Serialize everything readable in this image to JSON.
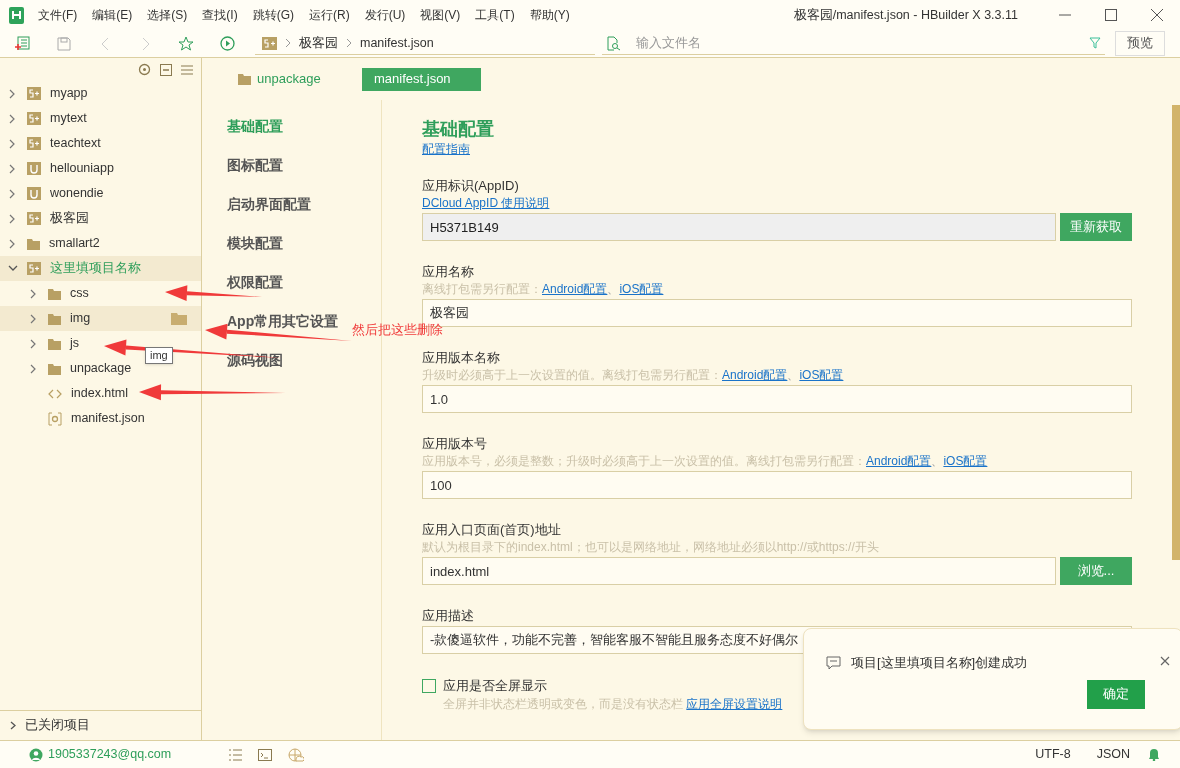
{
  "window": {
    "title": "极客园/manifest.json - HBuilder X 3.3.11"
  },
  "menu": [
    "文件(F)",
    "编辑(E)",
    "选择(S)",
    "查找(I)",
    "跳转(G)",
    "运行(R)",
    "发行(U)",
    "视图(V)",
    "工具(T)",
    "帮助(Y)"
  ],
  "toolbar": {
    "breadcrumb": [
      "极客园",
      "manifest.json"
    ],
    "search": {
      "placeholder": "输入文件名"
    },
    "preview_button": "预览"
  },
  "sidebar": {
    "items": [
      {
        "label": "myapp",
        "kind": "project",
        "expanded": false,
        "highlighted": false,
        "current": false
      },
      {
        "label": "mytext",
        "kind": "project",
        "expanded": false,
        "highlighted": false,
        "current": false
      },
      {
        "label": "teachtext",
        "kind": "project",
        "expanded": false,
        "highlighted": false,
        "current": false
      },
      {
        "label": "hellouniapp",
        "kind": "uniproject",
        "expanded": false,
        "highlighted": false,
        "current": false
      },
      {
        "label": "wonendie",
        "kind": "uniproject",
        "expanded": false,
        "highlighted": false,
        "current": false
      },
      {
        "label": "极客园",
        "kind": "project",
        "expanded": false,
        "highlighted": false,
        "current": false
      },
      {
        "label": "smallart2",
        "kind": "folder",
        "expanded": false,
        "highlighted": false,
        "current": false
      },
      {
        "label": "这里填项目名称",
        "kind": "project",
        "expanded": true,
        "highlighted": true,
        "current": true,
        "children": [
          {
            "label": "css",
            "kind": "folder",
            "expanded": false,
            "highlighted": false,
            "current": false
          },
          {
            "label": "img",
            "kind": "folder",
            "expanded": false,
            "highlighted": true,
            "current": false
          },
          {
            "label": "js",
            "kind": "folder",
            "expanded": false,
            "highlighted": false,
            "current": false
          },
          {
            "label": "unpackage",
            "kind": "folder",
            "expanded": false,
            "highlighted": false,
            "current": false
          },
          {
            "label": "index.html",
            "kind": "html",
            "highlighted": false,
            "current": false
          },
          {
            "label": "manifest.json",
            "kind": "json",
            "highlighted": false,
            "current": false
          }
        ]
      }
    ],
    "closed_projects": "已关闭项目"
  },
  "editor": {
    "tabs": [
      {
        "label": "unpackage",
        "kind": "folder",
        "selected": false
      },
      {
        "label": "manifest.json",
        "kind": "file",
        "selected": true
      }
    ],
    "nav": [
      {
        "label": "基础配置",
        "selected": true
      },
      {
        "label": "图标配置",
        "selected": false
      },
      {
        "label": "启动界面配置",
        "selected": false
      },
      {
        "label": "模块配置",
        "selected": false
      },
      {
        "label": "权限配置",
        "selected": false
      },
      {
        "label": "App常用其它设置",
        "selected": false
      },
      {
        "label": "源码视图",
        "selected": false
      }
    ],
    "heading": "基础配置",
    "guide_link": "配置指南",
    "fields": [
      {
        "kind": "text",
        "label": "应用标识(AppID)",
        "links": [
          "DCloud AppID 使用说明"
        ],
        "value": "H5371B149",
        "readonly": true,
        "button": "重新获取"
      },
      {
        "kind": "text",
        "label": "应用名称",
        "hint": "离线打包需另行配置：",
        "links": [
          "Android配置",
          "iOS配置"
        ],
        "separator": "、",
        "value": "极客园",
        "readonly": false
      },
      {
        "kind": "text",
        "label": "应用版本名称",
        "hint": "升级时必须高于上一次设置的值。离线打包需另行配置：",
        "links": [
          "Android配置",
          "iOS配置"
        ],
        "separator": "、",
        "value": "1.0",
        "readonly": false
      },
      {
        "kind": "text",
        "label": "应用版本号",
        "hint": "应用版本号，必须是整数；升级时必须高于上一次设置的值。离线打包需另行配置：",
        "links": [
          "Android配置",
          "iOS配置"
        ],
        "separator": "、",
        "value": "100",
        "readonly": false
      },
      {
        "kind": "text",
        "label": "应用入口页面(首页)地址",
        "hint": "默认为根目录下的index.html；也可以是网络地址，网络地址必须以http://或https://开头",
        "value": "index.html",
        "readonly": false,
        "button": "浏览..."
      },
      {
        "kind": "text",
        "label": "应用描述",
        "value": "-款傻逼软件，功能不完善，智能客服不智能且服务态度不好偶尔",
        "readonly": false
      },
      {
        "kind": "checkbox",
        "label": "应用是否全屏显示",
        "checked": false,
        "hint": "全屏并非状态栏透明或变色，而是没有状态栏 ",
        "links": [
          "应用全屏设置说明"
        ]
      }
    ]
  },
  "toast": {
    "message": "项目[这里填项目名称]创建成功",
    "button": "确定"
  },
  "status_bar": {
    "account": "1905337243@qq.com",
    "encoding": "UTF-8",
    "language": "JSON"
  },
  "annotations": {
    "note": "然后把这些删除",
    "tooltip": "img",
    "arrows": [
      {
        "kind": "arrow"
      },
      {
        "kind": "arrow"
      },
      {
        "kind": "arrow"
      },
      {
        "kind": "arrow"
      }
    ]
  }
}
